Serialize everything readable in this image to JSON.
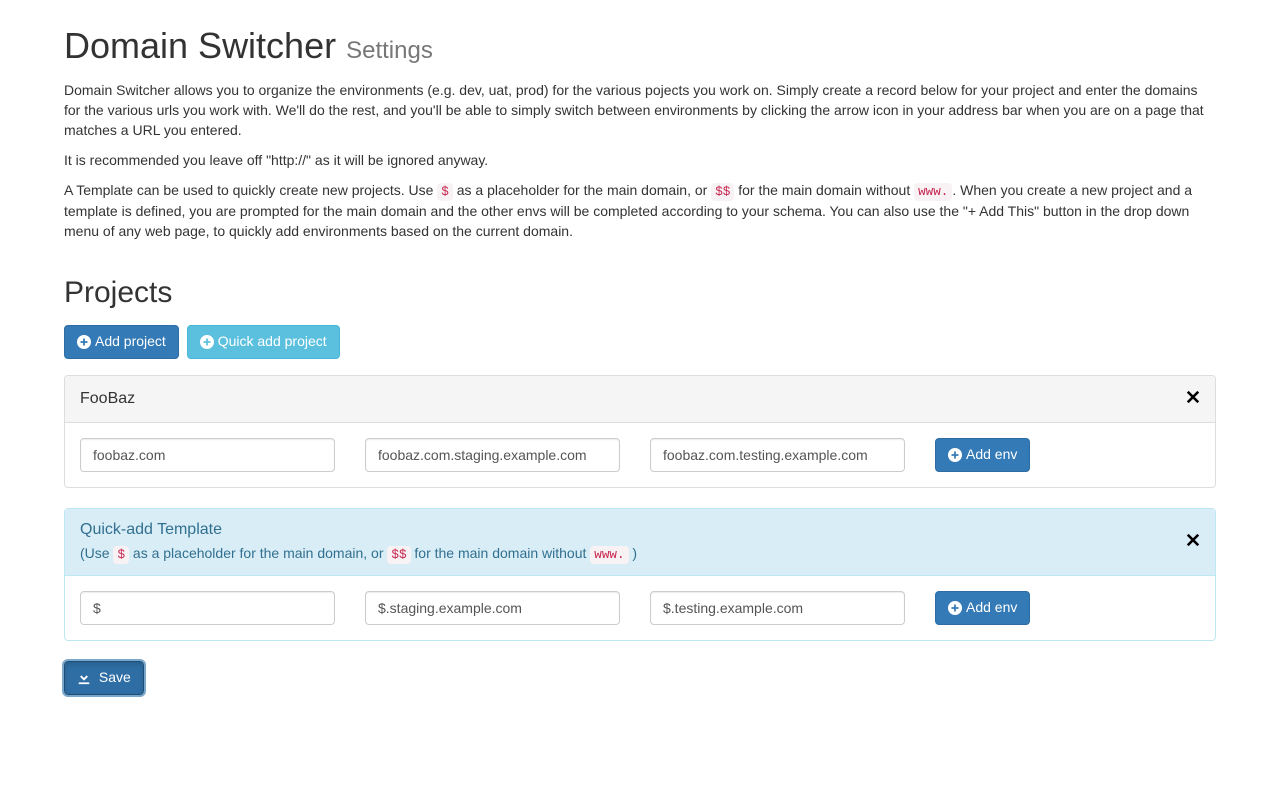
{
  "header": {
    "title": "Domain Switcher",
    "subtitle": "Settings"
  },
  "intro": {
    "p1": "Domain Switcher allows you to organize the environments (e.g. dev, uat, prod) for the various pojects you work on. Simply create a record below for your project and enter the domains for the various urls you work with. We'll do the rest, and you'll be able to simply switch between environments by clicking the arrow icon in your address bar when you are on a page that matches a URL you entered.",
    "p2": "It is recommended you leave off \"http://\" as it will be ignored anyway.",
    "p3a": "A Template can be used to quickly create new projects. Use ",
    "p3_code1": "$",
    "p3b": " as a placeholder for the main domain, or ",
    "p3_code2": "$$",
    "p3c": " for the main domain without ",
    "p3_code3": "www.",
    "p3d": ". When you create a new project and a template is defined, you are prompted for the main domain and the other envs will be completed according to your schema. You can also use the \"+ Add This\" button in the drop down menu of any web page, to quickly add environments based on the current domain."
  },
  "projects_heading": "Projects",
  "buttons": {
    "add_project": "Add project",
    "quick_add_project": "Quick add project",
    "add_env": "Add env",
    "save": "Save"
  },
  "project": {
    "name": "FooBaz",
    "envs": [
      "foobaz.com",
      "foobaz.com.staging.example.com",
      "foobaz.com.testing.example.com"
    ]
  },
  "template": {
    "title": "Quick-add Template",
    "hint_a": "(Use ",
    "hint_code1": "$",
    "hint_b": " as a placeholder for the main domain, or ",
    "hint_code2": "$$",
    "hint_c": " for the main domain without ",
    "hint_code3": "www.",
    "hint_d": " )",
    "envs": [
      "$",
      "$.staging.example.com",
      "$.testing.example.com"
    ]
  }
}
